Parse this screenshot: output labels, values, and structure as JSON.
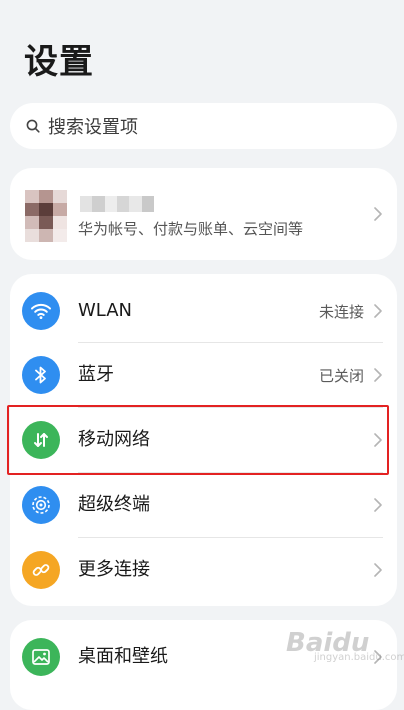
{
  "header": {
    "title": "设置"
  },
  "search": {
    "placeholder": "搜索设置项"
  },
  "account": {
    "subtitle": "华为帐号、付款与账单、云空间等"
  },
  "settings": [
    {
      "label": "WLAN",
      "value": "未连接",
      "icon": "wifi-icon",
      "color": "#2f8ef0"
    },
    {
      "label": "蓝牙",
      "value": "已关闭",
      "icon": "bluetooth-icon",
      "color": "#2f8ef0"
    },
    {
      "label": "移动网络",
      "value": "",
      "icon": "mobile-data-icon",
      "color": "#3cb55a"
    },
    {
      "label": "超级终端",
      "value": "",
      "icon": "super-device-icon",
      "color": "#2f8ef0"
    },
    {
      "label": "更多连接",
      "value": "",
      "icon": "link-icon",
      "color": "#f5a623"
    }
  ],
  "settings2": [
    {
      "label": "桌面和壁纸",
      "icon": "wallpaper-icon",
      "color": "#3cb55a"
    }
  ],
  "watermark": {
    "text": "Baidu",
    "sub": "jingyan.baidu.com"
  }
}
